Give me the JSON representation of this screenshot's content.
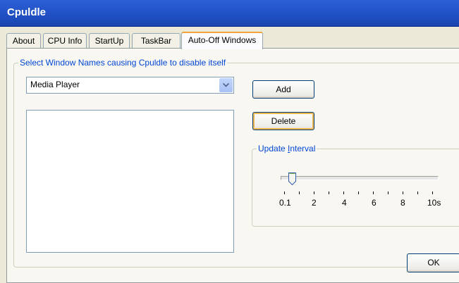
{
  "window": {
    "title": "Cpuldle"
  },
  "tabs": [
    {
      "label": "About"
    },
    {
      "label": "CPU Info"
    },
    {
      "label": "StartUp"
    },
    {
      "label": "TaskBar"
    },
    {
      "label": "Auto-Off Windows",
      "active": true
    }
  ],
  "window_names_group": {
    "legend": "Select Window Names causing Cpuldle to disable itself",
    "combo_value": "Media Player",
    "listbox_items": []
  },
  "buttons": {
    "add": "Add",
    "delete": "Delete",
    "ok": "OK"
  },
  "update_interval": {
    "legend": "Update Interval",
    "accelerator": "I",
    "value": 0.1,
    "tick_labels": [
      "0.1",
      "2",
      "4",
      "6",
      "8",
      "10s"
    ]
  },
  "colors": {
    "titlebar": "#2355cf",
    "legend_text": "#0046d5",
    "tab_active_accent": "#f0a33a",
    "default_button_accent": "#f0b650"
  }
}
